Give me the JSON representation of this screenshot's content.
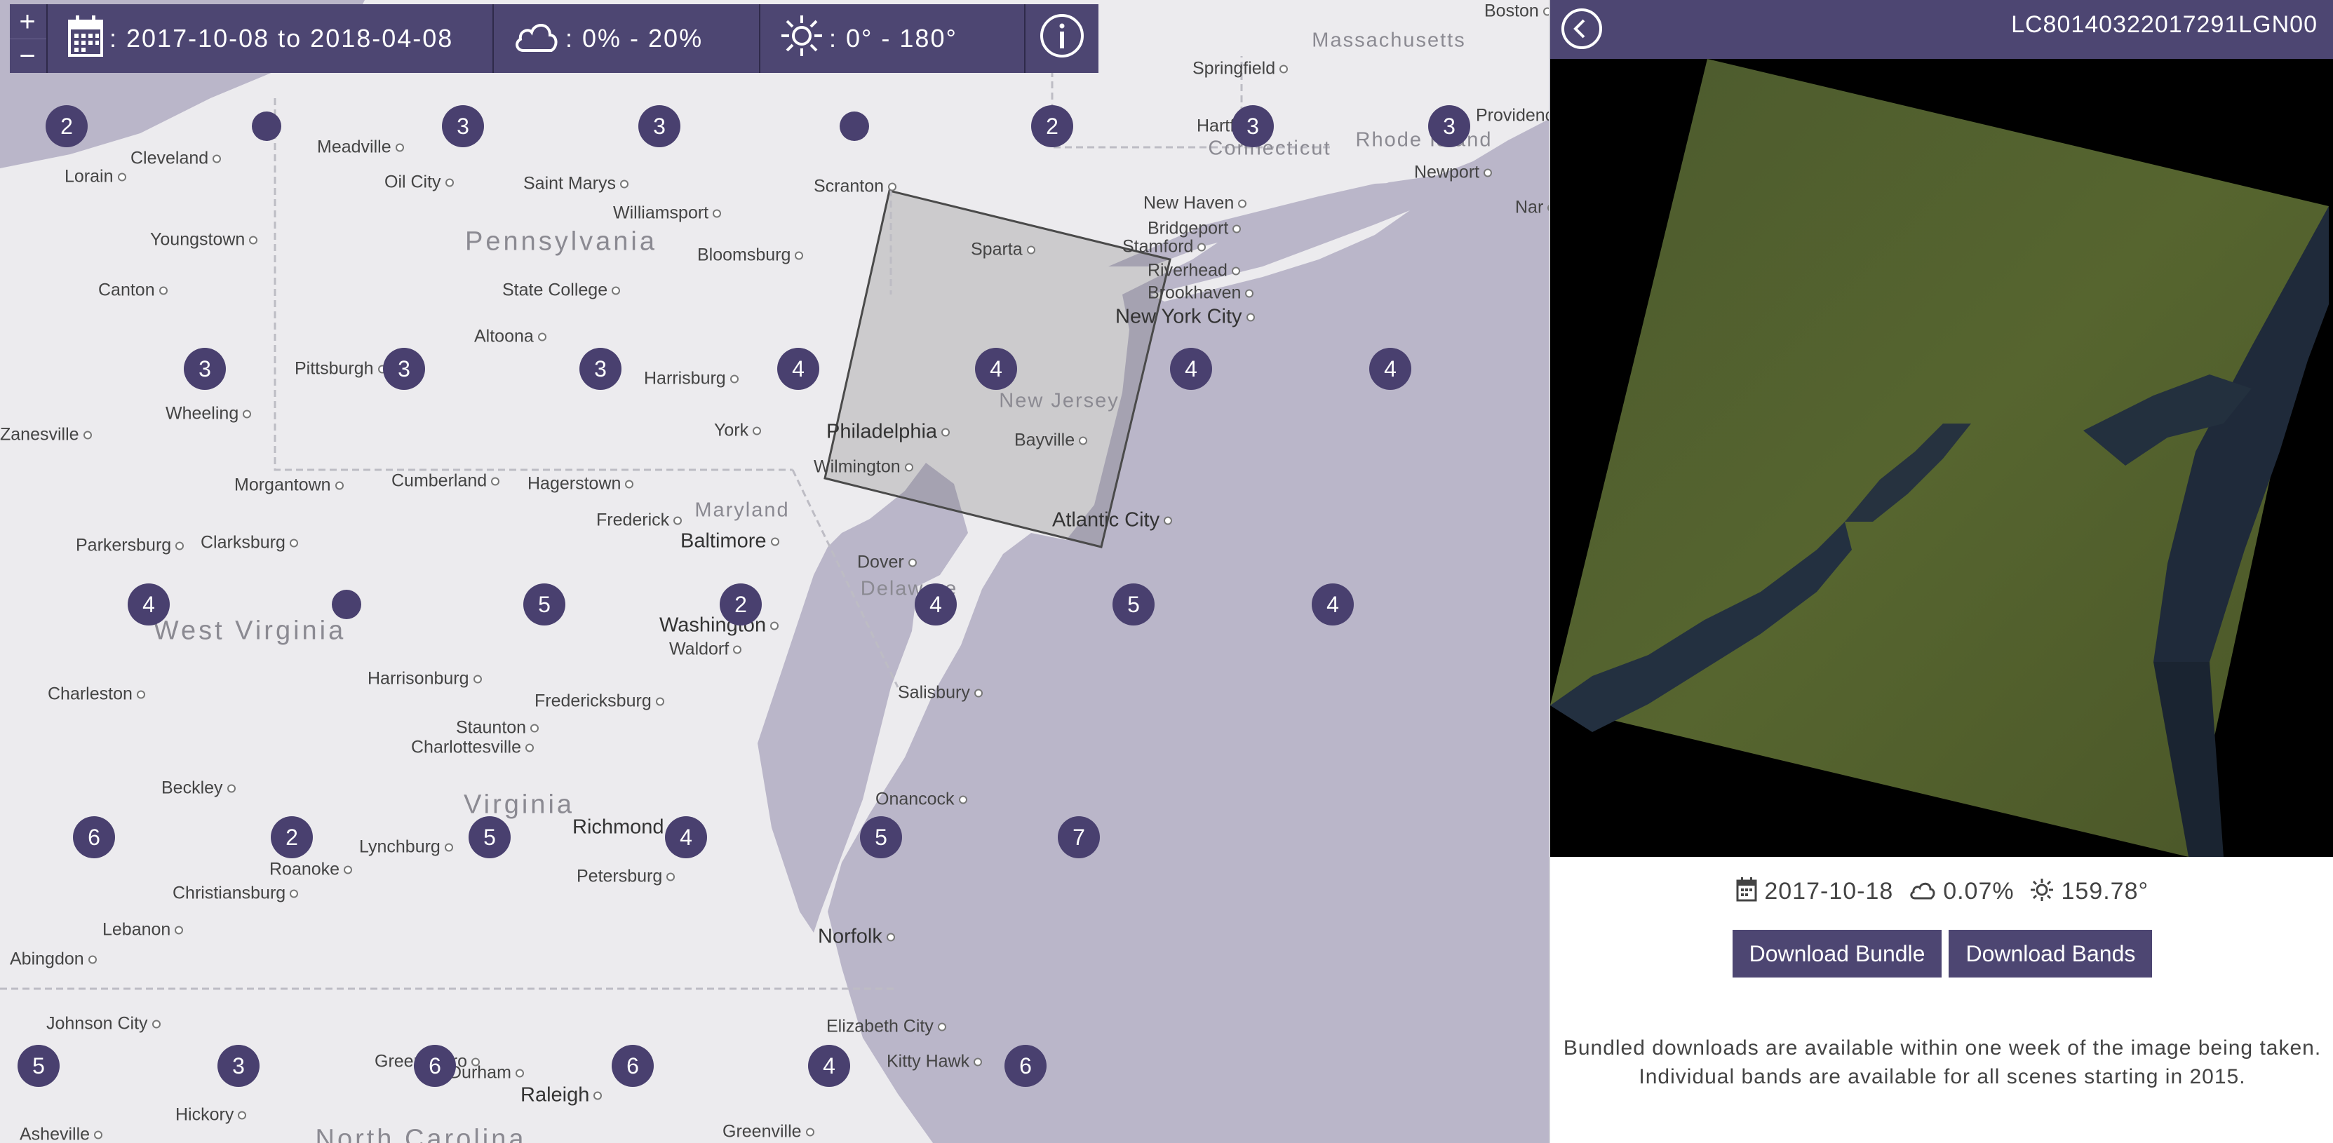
{
  "toolbar": {
    "zoom_in": "+",
    "zoom_out": "−",
    "date_range": ": 2017-10-08 to 2018-04-08",
    "cloud_range": ": 0% - 20%",
    "sun_range": ": 0° - 180°",
    "calendar_icon": "calendar-icon",
    "cloud_icon": "cloud-icon",
    "sun_icon": "sun-icon",
    "info_icon": "info-icon"
  },
  "map": {
    "regions": [
      "Pennsylvania",
      "New Jersey",
      "Maryland",
      "Delaware",
      "West Virginia",
      "Virginia",
      "North Carolina",
      "Massachusetts",
      "Connecticut",
      "Rhode Island"
    ],
    "cities": [
      "Boston",
      "Springfield",
      "Hartford",
      "Providence",
      "Newport",
      "New Haven",
      "Bridgeport",
      "Stamford",
      "Riverhead",
      "Brookhaven",
      "New York City",
      "Scranton",
      "Sparta",
      "Williamsport",
      "Bloomsburg",
      "State College",
      "Altoona",
      "Pittsburgh",
      "Harrisburg",
      "York",
      "Philadelphia",
      "Wilmington",
      "Bayville",
      "Atlantic City",
      "Cleveland",
      "Lorain",
      "Meadville",
      "Oil City",
      "Saint Marys",
      "Youngstown",
      "Canton",
      "Wheeling",
      "Zanesville",
      "Morgantown",
      "Cumberland",
      "Hagerstown",
      "Frederick",
      "Baltimore",
      "Dover",
      "Washington",
      "Waldorf",
      "Parkersburg",
      "Clarksburg",
      "Charleston",
      "Harrisonburg",
      "Staunton",
      "Charlottesville",
      "Fredericksburg",
      "Salisbury",
      "Beckley",
      "Richmond",
      "Petersburg",
      "Lynchburg",
      "Roanoke",
      "Christiansburg",
      "Onancock",
      "Norfolk",
      "Lebanon",
      "Abingdon",
      "Johnson City",
      "Elizabeth City",
      "Kitty Hawk",
      "Greensboro",
      "Durham",
      "Raleigh",
      "Hickory",
      "Asheville",
      "Greenville",
      "Nar"
    ],
    "clusters": [
      "2",
      "",
      "3",
      "3",
      "",
      "2",
      "3",
      "3",
      "3",
      "3",
      "3",
      "4",
      "4",
      "4",
      "4",
      "4",
      "",
      "5",
      "2",
      "4",
      "5",
      "4",
      "6",
      "2",
      "5",
      "4",
      "5",
      "7",
      "5",
      "3",
      "6",
      "6",
      "4",
      "6"
    ],
    "footprint_color": "#8a8a8a"
  },
  "panel": {
    "back_icon": "back-arrow-icon",
    "scene_id": "LC80140322017291LGN00",
    "date": "2017-10-18",
    "cloud_cover": "0.07%",
    "sun_azimuth": "159.78°",
    "download_bundle": "Download Bundle",
    "download_bands": "Download Bands",
    "note_line1": "Bundled downloads are available within one week of the image being taken.",
    "note_line2": "Individual bands are available for all scenes starting in 2015."
  },
  "colors": {
    "accent": "#4d4672",
    "cluster": "#49406f",
    "water": "#bab6c9",
    "land": "#ecebee"
  }
}
